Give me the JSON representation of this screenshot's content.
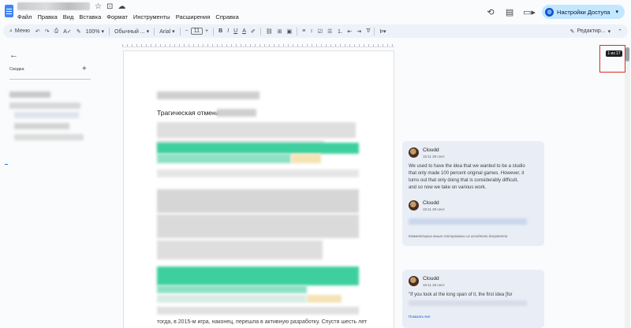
{
  "title_bar": {
    "menu": [
      "Файл",
      "Правка",
      "Вид",
      "Вставка",
      "Формат",
      "Инструменты",
      "Расширения",
      "Справка"
    ],
    "share_label": "Настройки Доступа",
    "icons": [
      "star-icon",
      "move-to-folder-icon",
      "cloud-saved-icon",
      "history-icon",
      "comment-icon",
      "video-icon",
      "globe-icon"
    ]
  },
  "toolbar": {
    "search_label": "Меню",
    "zoom": "100%",
    "style": "Обычный ...",
    "font": "Arial",
    "font_size": "11",
    "bold": "B",
    "italic": "I",
    "underline": "U",
    "text_color": "A",
    "mode_label": "Редактир..."
  },
  "outline": {
    "label": "Сводка",
    "add": "+"
  },
  "document": {
    "heading": "Трагическая отмена",
    "bottom_text": "тогда, в 2015-м игра, наконец, перешла в активную разработку. Спустя шесть лет"
  },
  "comments": [
    {
      "author": "Cloudd",
      "date": "15:11 28 сент.",
      "text_lines": [
        "We used to have the idea that we wanted to be a studio",
        "that only made 100 percent original games. However, it",
        "turns out that only doing that is considerably difficult,",
        "and so now we take on various work."
      ]
    },
    {
      "author": "Cloudd",
      "date": "15:11 28 сент.",
      "note": "Комментарии выше скопированы из исходного документа"
    },
    {
      "author": "Cloudd",
      "date": "15:11 28 сент.",
      "text_lines": [
        "\"If you look at the long span of it, the first idea [for"
      ],
      "link": "Показать все"
    }
  ],
  "page_badge": "1 из 17",
  "colors": {
    "accent": "#0b57d0",
    "share_bg": "#c2e7ff",
    "toolbar_bg": "#edf2fa",
    "comment_bg": "#e9eef6",
    "highlight_green": "#3ecf9e",
    "highlight_yellow": "#f4e3b5",
    "annotation_red": "#d93025"
  }
}
